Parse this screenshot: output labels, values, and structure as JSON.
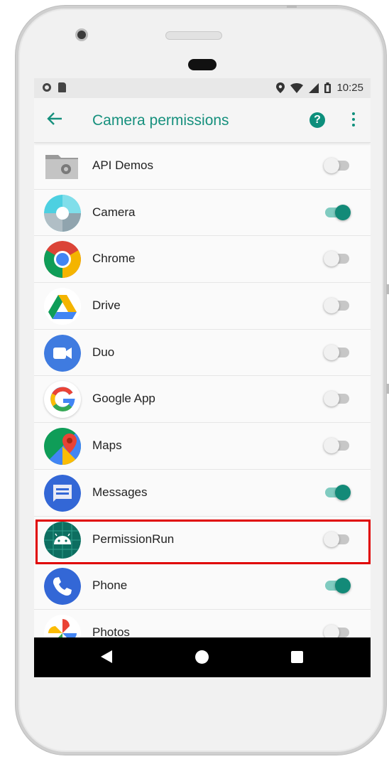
{
  "status_bar": {
    "time": "10:25"
  },
  "app_bar": {
    "title": "Camera permissions"
  },
  "apps": [
    {
      "label": "API Demos",
      "icon": "folder-gear-icon",
      "enabled": false
    },
    {
      "label": "Camera",
      "icon": "camera-app-icon",
      "enabled": true
    },
    {
      "label": "Chrome",
      "icon": "chrome-icon",
      "enabled": false
    },
    {
      "label": "Drive",
      "icon": "drive-icon",
      "enabled": false
    },
    {
      "label": "Duo",
      "icon": "duo-icon",
      "enabled": false
    },
    {
      "label": "Google App",
      "icon": "google-icon",
      "enabled": false
    },
    {
      "label": "Maps",
      "icon": "maps-icon",
      "enabled": false
    },
    {
      "label": "Messages",
      "icon": "messages-icon",
      "enabled": true
    },
    {
      "label": "PermissionRun",
      "icon": "android-icon",
      "enabled": false
    },
    {
      "label": "Phone",
      "icon": "phone-icon",
      "enabled": true
    },
    {
      "label": "Photos",
      "icon": "photos-icon",
      "enabled": false
    }
  ],
  "colors": {
    "accent": "#16907d",
    "highlight": "#e00000",
    "toggle_on": "#138a78"
  }
}
